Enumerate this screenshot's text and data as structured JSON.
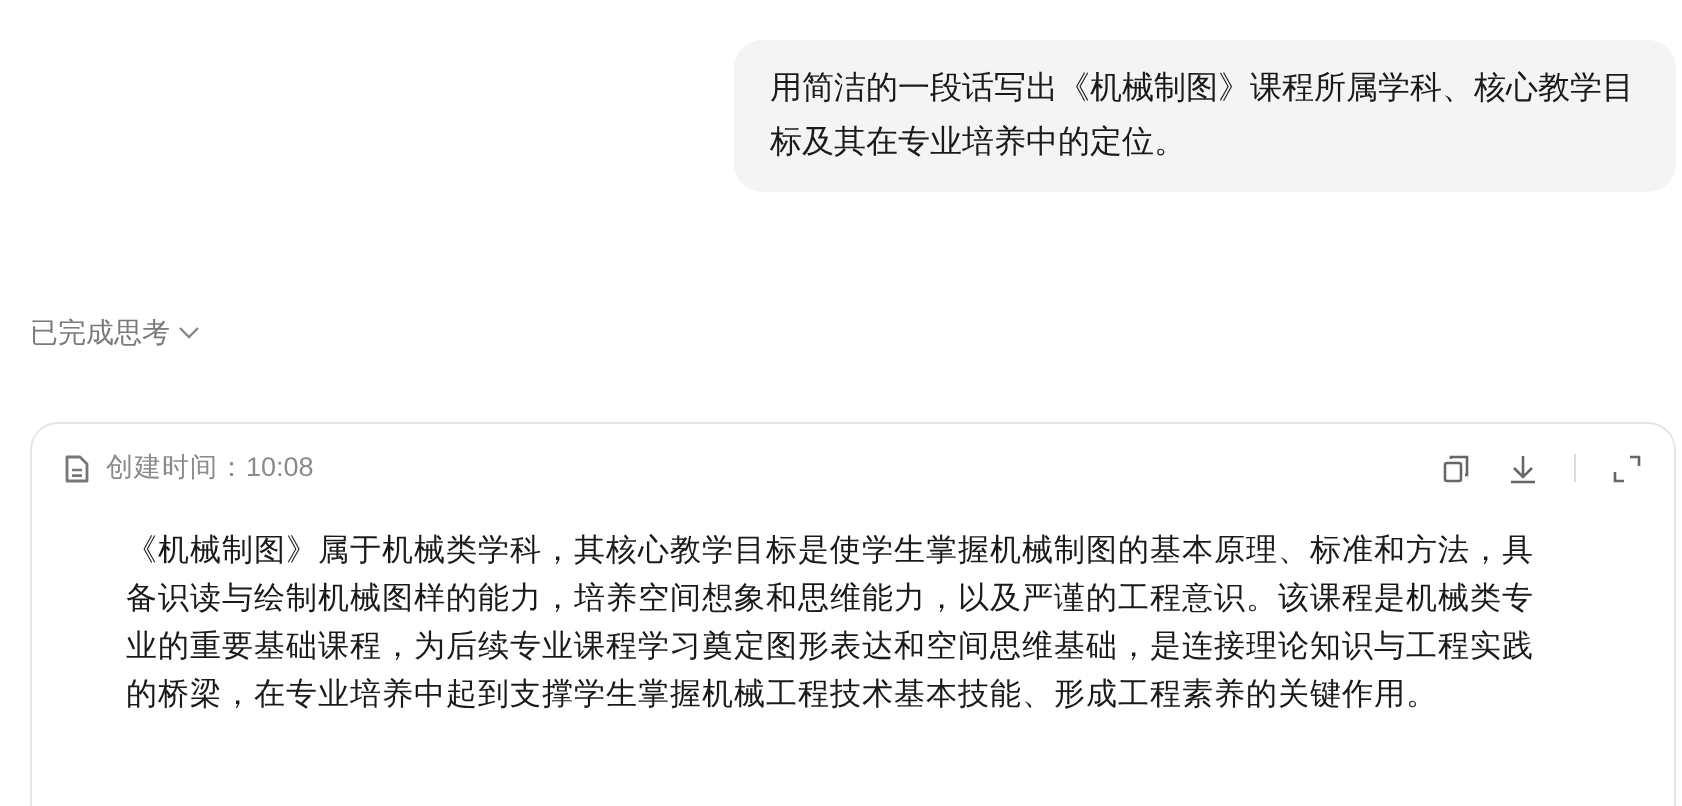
{
  "user_message": {
    "text": "用简洁的一段话写出《机械制图》课程所属学科、核心教学目标及其在专业培养中的定位。"
  },
  "thinking_status": {
    "label": "已完成思考",
    "expanded": false
  },
  "document": {
    "created_label": "创建时间：10:08",
    "body": "《机械制图》属于机械类学科，其核心教学目标是使学生掌握机械制图的基本原理、标准和方法，具备识读与绘制机械图样的能力，培养空间想象和思维能力，以及严谨的工程意识。该课程是机械类专业的重要基础课程，为后续专业课程学习奠定图形表达和空间思维基础，是连接理论知识与工程实践的桥梁，在专业培养中起到支撑学生掌握机械工程技术基本技能、形成工程素养的关键作用。"
  }
}
